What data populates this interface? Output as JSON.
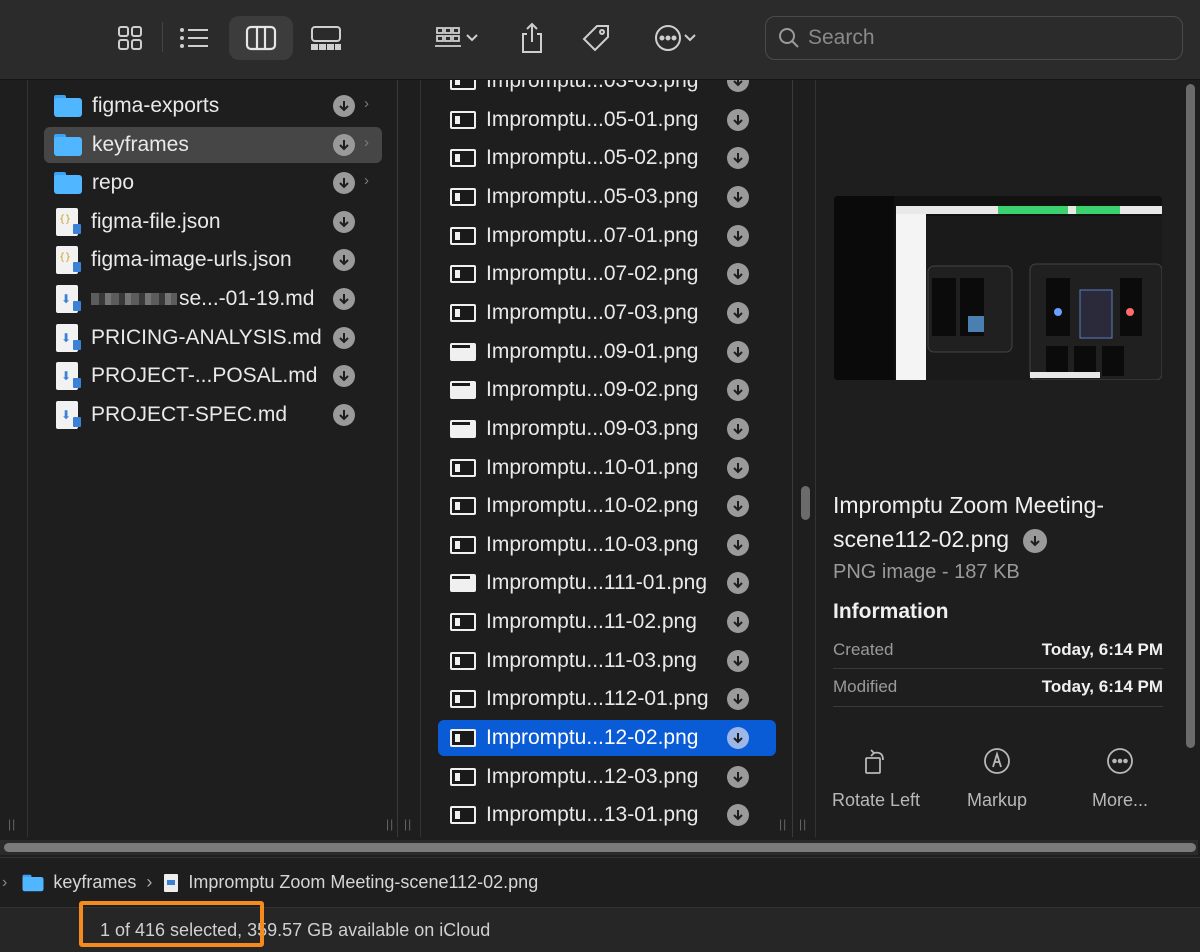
{
  "toolbar": {
    "search_placeholder": "Search",
    "view_buttons": [
      "icon-view",
      "list-view",
      "column-view",
      "gallery-view"
    ],
    "active_view": "column-view"
  },
  "sidebar_column": {
    "items": [
      {
        "label": "figma-exports",
        "type": "folder"
      },
      {
        "label": "keyframes",
        "type": "folder",
        "selected": true
      },
      {
        "label": "repo",
        "type": "folder"
      },
      {
        "label": "figma-file.json",
        "type": "json"
      },
      {
        "label": "figma-image-urls.json",
        "type": "json"
      },
      {
        "label": "se...-01-19.md",
        "type": "md"
      },
      {
        "label": "PRICING-ANALYSIS.md",
        "type": "md"
      },
      {
        "label": "PROJECT-...POSAL.md",
        "type": "md"
      },
      {
        "label": "PROJECT-SPEC.md",
        "type": "md"
      }
    ]
  },
  "files_column": {
    "items": [
      {
        "label": "Impromptu...03-03.png"
      },
      {
        "label": "Impromptu...05-01.png"
      },
      {
        "label": "Impromptu...05-02.png"
      },
      {
        "label": "Impromptu...05-03.png"
      },
      {
        "label": "Impromptu...07-01.png"
      },
      {
        "label": "Impromptu...07-02.png"
      },
      {
        "label": "Impromptu...07-03.png"
      },
      {
        "label": "Impromptu...09-01.png"
      },
      {
        "label": "Impromptu...09-02.png"
      },
      {
        "label": "Impromptu...09-03.png"
      },
      {
        "label": "Impromptu...10-01.png"
      },
      {
        "label": "Impromptu...10-02.png"
      },
      {
        "label": "Impromptu...10-03.png"
      },
      {
        "label": "Impromptu...111-01.png"
      },
      {
        "label": "Impromptu...11-02.png"
      },
      {
        "label": "Impromptu...11-03.png"
      },
      {
        "label": "Impromptu...112-01.png"
      },
      {
        "label": "Impromptu...12-02.png",
        "selected": true
      },
      {
        "label": "Impromptu...12-03.png"
      },
      {
        "label": "Impromptu...13-01.png"
      }
    ]
  },
  "preview": {
    "title": "Impromptu Zoom Meeting-scene112-02.png",
    "subtitle": "PNG image - 187 KB",
    "info_heading": "Information",
    "created_label": "Created",
    "created_value": "Today, 6:14 PM",
    "modified_label": "Modified",
    "modified_value": "Today, 6:14 PM",
    "actions": [
      "Rotate Left",
      "Markup",
      "More..."
    ]
  },
  "pathbar": {
    "folder": "keyframes",
    "file": "Impromptu Zoom Meeting-scene112-02.png"
  },
  "status": {
    "selection": "1 of 416 selected",
    "available": ", 359.57 GB available on iCloud"
  },
  "colors": {
    "selection_blue": "#0a5bd6",
    "folder_blue": "#4fb6ff",
    "annotation_orange": "#f58a1f"
  }
}
